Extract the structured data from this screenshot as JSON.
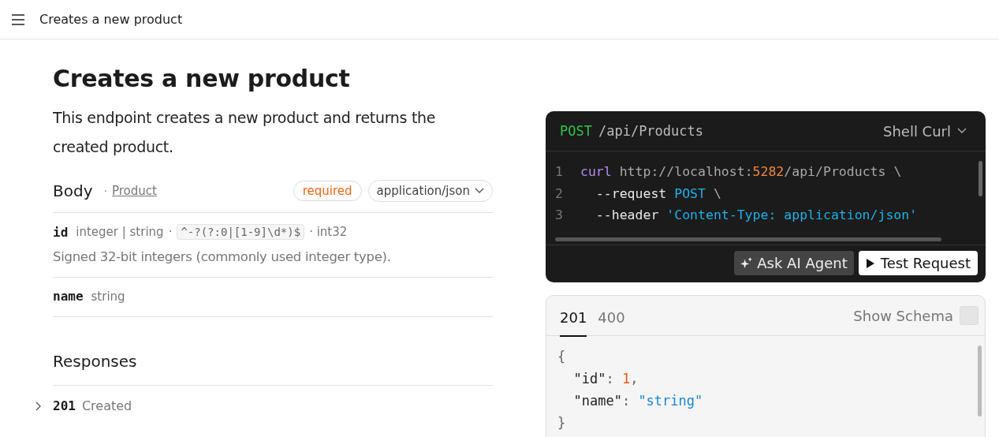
{
  "header": {
    "title": "Creates a new product"
  },
  "page": {
    "title": "Creates a new product",
    "description": "This endpoint creates a new product and returns the created product."
  },
  "body": {
    "label": "Body",
    "separator": "·",
    "schema_link": "Product",
    "required": "required",
    "content_type": "application/json",
    "fields": [
      {
        "name": "id",
        "type": "integer | string",
        "separator": "·",
        "pattern": "^-?(?:0|[1-9]\\d*)$",
        "format": "· int32",
        "description": "Signed 32-bit integers (commonly used integer type)."
      },
      {
        "name": "name",
        "type": "string"
      }
    ]
  },
  "responses": {
    "heading": "Responses",
    "items": [
      {
        "code": "201",
        "text": "Created",
        "expanded": false
      }
    ]
  },
  "request": {
    "method": "POST",
    "path": "/api/Products",
    "language": "Shell Curl",
    "lines": [
      {
        "number": "1",
        "tokens": [
          {
            "kind": "keyword",
            "text": "curl"
          },
          {
            "kind": "plain",
            "text": " http://localhost:"
          },
          {
            "kind": "number",
            "text": "5282"
          },
          {
            "kind": "plain",
            "text": "/api/Products \\"
          }
        ]
      },
      {
        "number": "2",
        "tokens": [
          {
            "kind": "flag",
            "text": "  --request"
          },
          {
            "kind": "string",
            "text": " POST"
          },
          {
            "kind": "plain",
            "text": " \\"
          }
        ]
      },
      {
        "number": "3",
        "tokens": [
          {
            "kind": "flag",
            "text": "  --header"
          },
          {
            "kind": "string",
            "text": " 'Content-Type: application/json'"
          }
        ]
      }
    ],
    "buttons": [
      {
        "kind": "ai",
        "label": "Ask AI Agent"
      },
      {
        "kind": "test",
        "label": "Test Request"
      }
    ]
  },
  "response_example": {
    "tabs": [
      {
        "label": "201",
        "selected": true
      },
      {
        "label": "400",
        "selected": false
      }
    ],
    "show_schema": {
      "label": "Show Schema",
      "checked": false
    },
    "lines": [
      [
        {
          "kind": "punct",
          "text": "{"
        }
      ],
      [
        {
          "kind": "key",
          "text": "  \"id\""
        },
        {
          "kind": "punct",
          "text": ": "
        },
        {
          "kind": "number",
          "text": "1"
        },
        {
          "kind": "punct",
          "text": ","
        }
      ],
      [
        {
          "kind": "key",
          "text": "  \"name\""
        },
        {
          "kind": "punct",
          "text": ": "
        },
        {
          "kind": "string",
          "text": "\"string\""
        }
      ],
      [
        {
          "kind": "punct",
          "text": "}"
        }
      ]
    ]
  }
}
